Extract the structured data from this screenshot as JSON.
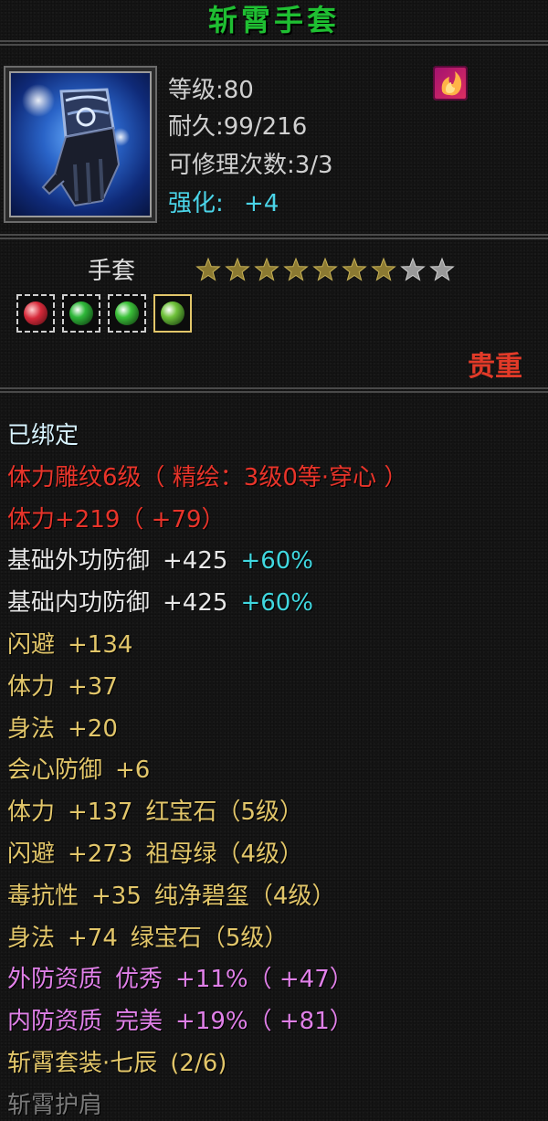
{
  "title": "斩霄手套",
  "stats": {
    "level": "等级:80",
    "durability": "耐久:99/216",
    "repair": "可修理次数:3/3",
    "enhance_label": "强化:",
    "enhance_value": "+4"
  },
  "type_label": "手套",
  "stars": {
    "filled": 7,
    "total": 9
  },
  "gems": [
    {
      "icon": "ruby-gem-icon",
      "color": "#d62a3a",
      "selected": false
    },
    {
      "icon": "emerald-gem-icon",
      "color": "#2fb83a",
      "selected": false
    },
    {
      "icon": "emerald-gem-icon",
      "color": "#3cc23a",
      "selected": false
    },
    {
      "icon": "jade-gem-icon",
      "color": "#6fc23a",
      "selected": true
    }
  ],
  "rarity": "贵重",
  "props": [
    {
      "name": "bound-status",
      "color": "bound",
      "parts": [
        "已绑定"
      ]
    },
    {
      "name": "engraving",
      "color": "red",
      "parts": [
        "体力雕纹6级（ 精绘：3级0等·穿心 ）"
      ]
    },
    {
      "name": "stamina-bonus",
      "color": "red",
      "parts": [
        "体力+219（ +79）"
      ]
    },
    {
      "name": "outer-defense",
      "color": "white",
      "parts": [
        "基础外功防御",
        "+425"
      ],
      "extra": "+60%"
    },
    {
      "name": "inner-defense",
      "color": "white",
      "parts": [
        "基础内功防御",
        "+425"
      ],
      "extra": "+60%"
    },
    {
      "name": "dodge",
      "color": "yellow",
      "parts": [
        "闪避",
        "+134"
      ]
    },
    {
      "name": "stamina",
      "color": "yellow",
      "parts": [
        "体力",
        "+37"
      ]
    },
    {
      "name": "agility",
      "color": "yellow",
      "parts": [
        "身法",
        "+20"
      ]
    },
    {
      "name": "crit-defense",
      "color": "yellow",
      "parts": [
        "会心防御",
        "+6"
      ]
    },
    {
      "name": "gem-ruby",
      "color": "yellow",
      "parts": [
        "体力",
        "+137",
        "红宝石（5级）"
      ]
    },
    {
      "name": "gem-emerald",
      "color": "yellow",
      "parts": [
        "闪避",
        "+273",
        "祖母绿（4级）"
      ]
    },
    {
      "name": "gem-jade",
      "color": "yellow",
      "parts": [
        "毒抗性",
        "+35",
        "纯净碧玺（4级）"
      ]
    },
    {
      "name": "gem-green",
      "color": "yellow",
      "parts": [
        "身法",
        "+74",
        "绿宝石（5级）"
      ]
    },
    {
      "name": "outer-quality",
      "color": "pink",
      "parts": [
        "外防资质",
        "优秀",
        "+11%（ +47）"
      ]
    },
    {
      "name": "inner-quality",
      "color": "pink",
      "parts": [
        "内防资质",
        "完美",
        "+19%（ +81）"
      ]
    },
    {
      "name": "set-bonus",
      "color": "yellow",
      "parts": [
        "斩霄套装·七辰",
        "(2/6)"
      ]
    },
    {
      "name": "set-item-shoulder",
      "color": "gray",
      "parts": [
        "斩霄护肩"
      ]
    }
  ]
}
